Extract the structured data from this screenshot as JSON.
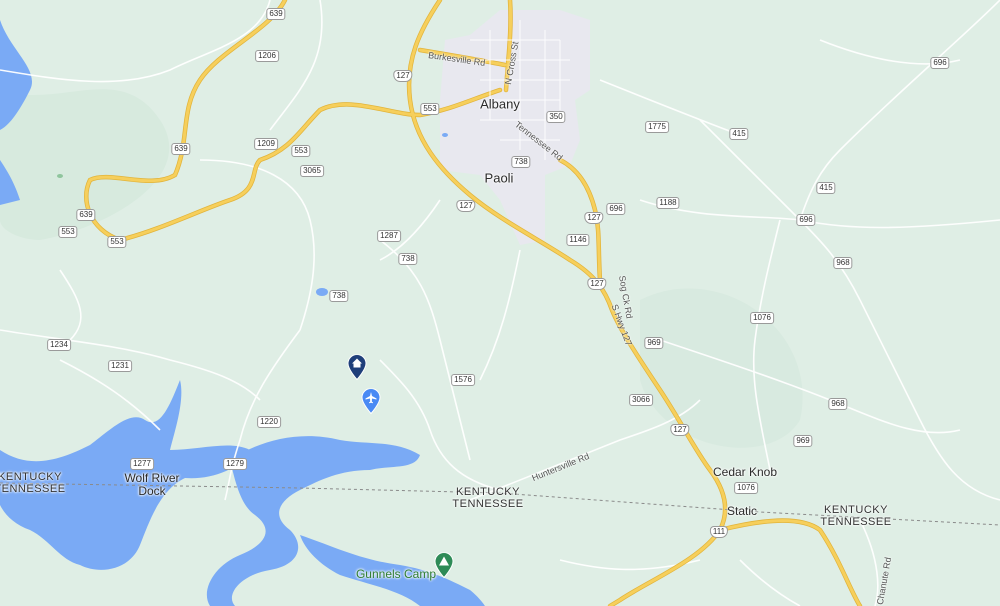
{
  "map": {
    "places": [
      {
        "id": "albany",
        "name": "Albany"
      },
      {
        "id": "paoli",
        "name": "Paoli"
      },
      {
        "id": "cedar-knob",
        "name": "Cedar Knob"
      },
      {
        "id": "static",
        "name": "Static"
      },
      {
        "id": "wolf-river-dock",
        "name": "Wolf River\nDock"
      },
      {
        "id": "gunnels-camp",
        "name": "Gunnels Camp"
      }
    ],
    "state_labels": [
      {
        "id": "left",
        "top": "KENTUCKY",
        "bottom": "TENNESSEE"
      },
      {
        "id": "center",
        "top": "KENTUCKY",
        "bottom": "TENNESSEE"
      },
      {
        "id": "right",
        "top": "KENTUCKY",
        "bottom": "TENNESSEE"
      }
    ],
    "road_names": [
      {
        "id": "burkesville",
        "name": "Burkesville Rd"
      },
      {
        "id": "ncross",
        "name": "N Cross St"
      },
      {
        "id": "tennessee",
        "name": "Tennessee Rd"
      },
      {
        "id": "sogck",
        "name": "Sog Ck Rd"
      },
      {
        "id": "shwy",
        "name": "S Hwy 127"
      },
      {
        "id": "huntersville",
        "name": "Huntersville Rd"
      },
      {
        "id": "chanute",
        "name": "Chanute Rd"
      }
    ],
    "route_shields": [
      "639",
      "1206",
      "127",
      "553",
      "1209",
      "639",
      "3065",
      "553",
      "639",
      "553",
      "1287",
      "738",
      "738",
      "127",
      "553",
      "350",
      "738",
      "1775",
      "415",
      "696",
      "1188",
      "696",
      "415",
      "696",
      "127",
      "1146",
      "127",
      "968",
      "1076",
      "969",
      "3066",
      "1234",
      "1231",
      "1576",
      "1220",
      "1277",
      "1279",
      "127",
      "968",
      "969",
      "1076",
      "111"
    ],
    "markers": [
      {
        "id": "home",
        "icon": "home-pin-icon"
      },
      {
        "id": "airport",
        "icon": "airport-icon"
      },
      {
        "id": "camp",
        "icon": "campground-icon"
      }
    ],
    "colors": {
      "land": "#dfeee5",
      "water": "#7aaaf5",
      "highway": "#f6cf5c",
      "town": "#e8e8ef",
      "border": "#888888"
    }
  }
}
